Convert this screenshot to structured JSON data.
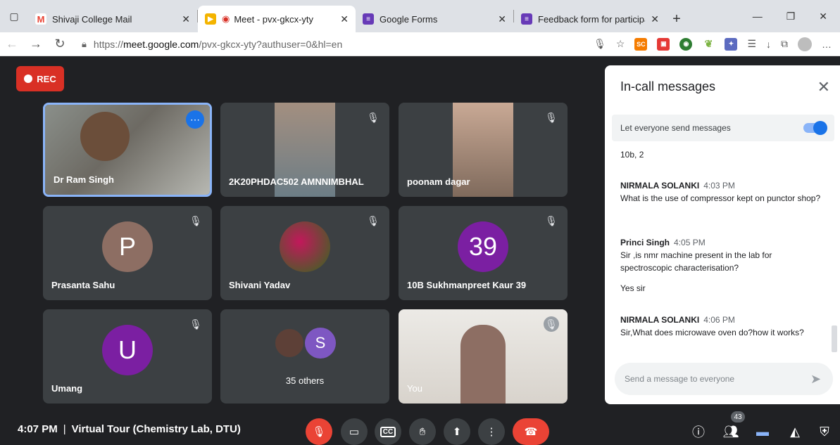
{
  "browser": {
    "tabs": [
      {
        "label": "Shivaji College Mail",
        "icon": "gmail-icon",
        "color": "#ea4335"
      },
      {
        "label": "Meet - pvx-gkcx-yty",
        "icon": "meet-icon",
        "color": "#d93025"
      },
      {
        "label": "Google Forms",
        "icon": "forms-icon",
        "color": "#673ab7"
      },
      {
        "label": "Feedback form for participants (",
        "icon": "forms-icon",
        "color": "#673ab7"
      }
    ],
    "url_prefix": "https://",
    "url_host": "meet.google.com",
    "url_path": "/pvx-gkcx-yty?authuser=0&hl=en"
  },
  "meet": {
    "rec_label": "REC",
    "tiles": [
      {
        "name": "Dr Ram Singh"
      },
      {
        "name": "2K20PHDAC502 AMNNIMBHAL"
      },
      {
        "name": "poonam dagar"
      },
      {
        "name": "Prasanta Sahu",
        "initial": "P",
        "color": "#8d6e63"
      },
      {
        "name": "Shivani Yadav"
      },
      {
        "name": "10B Sukhmanpreet Kaur 39",
        "initial": "39",
        "color": "#7b1fa2"
      },
      {
        "name": "Umang",
        "initial": "U",
        "color": "#7b1fa2"
      },
      {
        "name": "35 others",
        "initial": "S",
        "color": "#7e57c2"
      },
      {
        "name": "You"
      }
    ],
    "time": "4:07 PM",
    "meeting_title": "Virtual Tour (Chemistry Lab, DTU)",
    "participant_count": "43"
  },
  "chat": {
    "title": "In-call messages",
    "toggle_label": "Let everyone send messages",
    "messages": [
      {
        "text": "10b, 2"
      },
      {
        "who": "NIRMALA SOLANKI",
        "time": "4:03 PM",
        "text": "What is the use of compressor kept on punctor shop?"
      },
      {
        "who": "Princi Singh",
        "time": "4:05 PM",
        "text": "Sir ,is nmr machine present in the lab for spectroscopic characterisation?"
      },
      {
        "text": "Yes sir"
      },
      {
        "who": "NIRMALA SOLANKI",
        "time": "4:06 PM",
        "text": "Sir,What does microwave oven do?how it works?"
      }
    ],
    "input_placeholder": "Send a message to everyone"
  }
}
